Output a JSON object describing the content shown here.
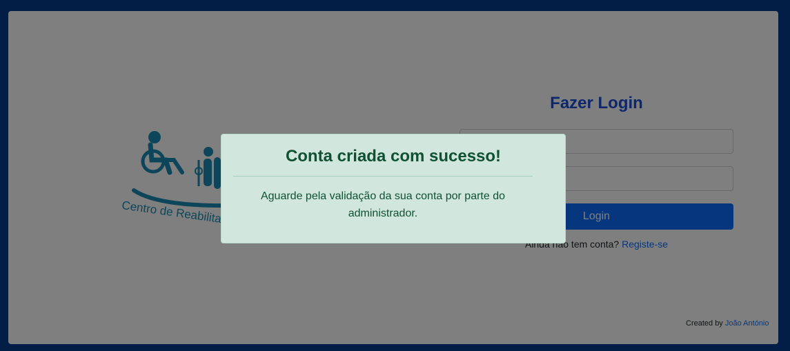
{
  "logo": {
    "text": "Centro de Reabilitação",
    "icon": "wheelchair-logo-icon",
    "color": "#1a8cb5"
  },
  "login": {
    "title": "Fazer Login",
    "email_placeholder": "",
    "password_placeholder": "",
    "button_label": "Login",
    "register_prompt": "Ainda não tem conta?",
    "register_link": "Registe-se"
  },
  "footer": {
    "created_by": "Created by",
    "author": "João António"
  },
  "modal": {
    "title": "Conta criada com sucesso!",
    "message": "Aguarde pela validação da sua conta por parte do administrador."
  },
  "colors": {
    "page_border": "#053a8c",
    "accent": "#0d6efd",
    "title": "#1a4ed8",
    "success_bg": "#d1e7dd",
    "success_text": "#0f5132"
  }
}
